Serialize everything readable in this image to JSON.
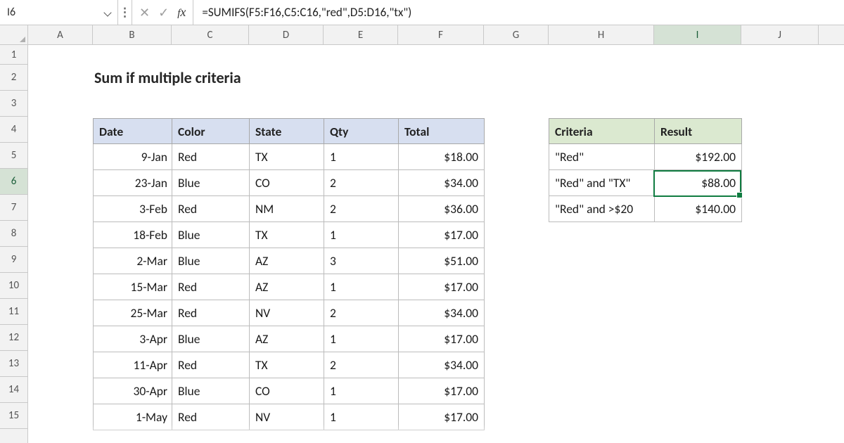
{
  "name_box": "I6",
  "formula": "=SUMIFS(F5:F16,C5:C16,\"red\",D5:D16,\"tx\")",
  "columns": [
    "A",
    "B",
    "C",
    "D",
    "E",
    "F",
    "G",
    "H",
    "I",
    "J"
  ],
  "active_column": "I",
  "rows": [
    "1",
    "2",
    "3",
    "4",
    "5",
    "6",
    "7",
    "8",
    "9",
    "10",
    "11",
    "12",
    "13",
    "14",
    "15"
  ],
  "active_row": "6",
  "title": "Sum if multiple criteria",
  "data_headers": {
    "date": "Date",
    "color": "Color",
    "state": "State",
    "qty": "Qty",
    "total": "Total"
  },
  "data_rows": [
    {
      "date": "9-Jan",
      "color": "Red",
      "state": "TX",
      "qty": "1",
      "total": "$18.00"
    },
    {
      "date": "23-Jan",
      "color": "Blue",
      "state": "CO",
      "qty": "2",
      "total": "$34.00"
    },
    {
      "date": "3-Feb",
      "color": "Red",
      "state": "NM",
      "qty": "2",
      "total": "$36.00"
    },
    {
      "date": "18-Feb",
      "color": "Blue",
      "state": "TX",
      "qty": "1",
      "total": "$17.00"
    },
    {
      "date": "2-Mar",
      "color": "Blue",
      "state": "AZ",
      "qty": "3",
      "total": "$51.00"
    },
    {
      "date": "15-Mar",
      "color": "Red",
      "state": "AZ",
      "qty": "1",
      "total": "$17.00"
    },
    {
      "date": "25-Mar",
      "color": "Red",
      "state": "NV",
      "qty": "2",
      "total": "$34.00"
    },
    {
      "date": "3-Apr",
      "color": "Blue",
      "state": "AZ",
      "qty": "1",
      "total": "$17.00"
    },
    {
      "date": "11-Apr",
      "color": "Red",
      "state": "TX",
      "qty": "2",
      "total": "$34.00"
    },
    {
      "date": "30-Apr",
      "color": "Blue",
      "state": "CO",
      "qty": "1",
      "total": "$17.00"
    },
    {
      "date": "1-May",
      "color": "Red",
      "state": "NV",
      "qty": "1",
      "total": "$17.00"
    }
  ],
  "crit_headers": {
    "criteria": "Criteria",
    "result": "Result"
  },
  "crit_rows": [
    {
      "criteria": "\"Red\"",
      "result": "$192.00"
    },
    {
      "criteria": "\"Red\" and \"TX\"",
      "result": "$88.00"
    },
    {
      "criteria": "\"Red\" and >$20",
      "result": "$140.00"
    }
  ]
}
